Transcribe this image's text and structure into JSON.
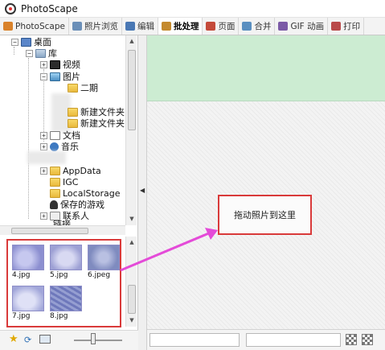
{
  "window": {
    "title": "PhotoScape"
  },
  "tabs": [
    {
      "label": "PhotoScape",
      "icon": "photoscape-icon",
      "color": "#d9822b"
    },
    {
      "label": "照片浏览",
      "icon": "viewer-icon",
      "color": "#6b8fb8"
    },
    {
      "label": "编辑",
      "icon": "editor-icon",
      "color": "#4a78b4"
    },
    {
      "label": "批处理",
      "icon": "batch-icon",
      "color": "#c48a2f"
    },
    {
      "label": "页面",
      "icon": "page-icon",
      "color": "#c44a3a"
    },
    {
      "label": "合并",
      "icon": "combine-icon",
      "color": "#5a8fc0"
    },
    {
      "label": "GIF 动画",
      "icon": "gif-icon",
      "color": "#7b5aa6"
    },
    {
      "label": "打印",
      "icon": "print-icon",
      "color": "#b94a4a"
    }
  ],
  "active_tab": "批处理",
  "tree": {
    "desktop": "桌面",
    "library": "库",
    "videos": "视频",
    "pictures": "图片",
    "folder_erqi": "二期",
    "new_folder_1": "新建文件夹",
    "new_folder_2": "新建文件夹",
    "documents": "文档",
    "music": "音乐",
    "appdata": "AppData",
    "igc": "IGC",
    "localstorage": "LocalStorage",
    "saved_games": "保存的游戏",
    "contacts": "联系人",
    "partial": "链接"
  },
  "thumbnails": [
    {
      "name": "4.jpg",
      "color": "#8c8fd0"
    },
    {
      "name": "5.jpg",
      "color": "#9da0d4"
    },
    {
      "name": "6.jpeg",
      "color": "#7f8bbf"
    },
    {
      "name": "7.jpg",
      "color": "#a1a6d9"
    },
    {
      "name": "8.jpg",
      "color": "#6e78bb"
    }
  ],
  "drop_hint": "拖动照片到这里",
  "colors": {
    "highlight_box": "#d93a3a",
    "pointer_arrow": "#e44bd8",
    "green_band": "#ccecd2"
  }
}
